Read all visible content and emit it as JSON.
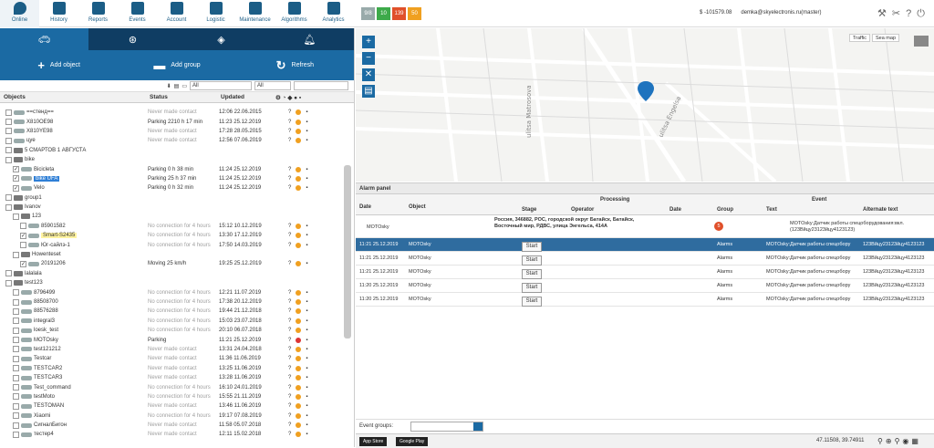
{
  "nav": [
    {
      "label": "Online",
      "icon": "pin-icon"
    },
    {
      "label": "History",
      "icon": "clock-icon"
    },
    {
      "label": "Reports",
      "icon": "reports-icon"
    },
    {
      "label": "Events",
      "icon": "bell-icon"
    },
    {
      "label": "Account",
      "icon": "account-icon"
    },
    {
      "label": "Logistic",
      "icon": "truck-icon"
    },
    {
      "label": "Maintenance",
      "icon": "car-icon"
    },
    {
      "label": "Algorithms",
      "icon": "algorithms-icon"
    },
    {
      "label": "Analytics",
      "icon": "analytics-icon"
    }
  ],
  "badges": [
    {
      "text": "9/8",
      "color": "#9aa"
    },
    {
      "text": "10",
      "color": "#3daa4a"
    },
    {
      "text": "139",
      "color": "#e0502a"
    },
    {
      "text": "50",
      "color": "#f0a020"
    }
  ],
  "account": {
    "balance": "$ -101579.08",
    "user": "demka@skyelectronis.ru(master)"
  },
  "left_tabs": [
    "car-tab",
    "wheel-tab",
    "layers-tab",
    "alarm-tab"
  ],
  "actions": {
    "add_object": "Add object",
    "add_group": "Add group",
    "refresh": "Refresh"
  },
  "filters": {
    "all1": "All",
    "all2": "All"
  },
  "columns": {
    "objects": "Objects",
    "status": "Status",
    "updated": "Updated"
  },
  "rows": [
    {
      "ind": 0,
      "type": "car",
      "name": "==стенд==",
      "status": "Never made contact",
      "updated": "12:06 22.06.2015",
      "gray": true
    },
    {
      "ind": 0,
      "type": "car",
      "name": "X810OE98",
      "status": "Parking 2210 h 17 min",
      "updated": "11:23 25.12.2019",
      "gray": false
    },
    {
      "ind": 0,
      "type": "car",
      "name": "X810YE98",
      "status": "Never made contact",
      "updated": "17:28 28.05.2015",
      "gray": true
    },
    {
      "ind": 0,
      "type": "car",
      "name": "цуе",
      "status": "Never made contact",
      "updated": "12:56 07.06.2019",
      "gray": true
    },
    {
      "ind": 0,
      "type": "folder",
      "name": "5 СМАРТОВ 1 АВГУСТА",
      "status": "",
      "updated": ""
    },
    {
      "ind": 0,
      "type": "folder",
      "name": "bike",
      "status": "",
      "updated": ""
    },
    {
      "ind": 1,
      "type": "car",
      "name": "Bicicleta",
      "status": "Parking 0 h 38 min",
      "updated": "11:24 25.12.2019",
      "gray": false,
      "check": true
    },
    {
      "ind": 1,
      "type": "car",
      "name": "bike UFA",
      "status": "Parking 25 h 37 min",
      "updated": "11:24 25.12.2019",
      "gray": false,
      "check": true,
      "hl": "blue"
    },
    {
      "ind": 1,
      "type": "car",
      "name": "Velo",
      "status": "Parking 0 h 32 min",
      "updated": "11:24 25.12.2019",
      "gray": false,
      "check": true
    },
    {
      "ind": 0,
      "type": "folder",
      "name": "group1",
      "status": "",
      "updated": ""
    },
    {
      "ind": 0,
      "type": "folder",
      "name": "Ivanov",
      "status": "",
      "updated": ""
    },
    {
      "ind": 1,
      "type": "folder",
      "name": "123",
      "status": "",
      "updated": ""
    },
    {
      "ind": 2,
      "type": "car",
      "name": "85901582",
      "status": "No connection for 4 hours",
      "updated": "15:12 10.12.2019",
      "gray": true
    },
    {
      "ind": 2,
      "type": "car",
      "name": "Smart-S2435",
      "status": "No connection for 4 hours",
      "updated": "13:30 17.12.2019",
      "gray": true,
      "check": true,
      "hl": "yellow"
    },
    {
      "ind": 2,
      "type": "car",
      "name": "Юг-сайлэ-1",
      "status": "No connection for 4 hours",
      "updated": "17:50 14.03.2019",
      "gray": true
    },
    {
      "ind": 1,
      "type": "folder",
      "name": "Howenteset",
      "status": "",
      "updated": ""
    },
    {
      "ind": 2,
      "type": "car",
      "name": "20191206",
      "status": "Moving 25 km/h",
      "updated": "19:25 25.12.2019",
      "gray": false,
      "check": true
    },
    {
      "ind": 0,
      "type": "folder",
      "name": "lalalala",
      "status": "",
      "updated": ""
    },
    {
      "ind": 0,
      "type": "folder",
      "name": "test123",
      "status": "",
      "updated": ""
    },
    {
      "ind": 1,
      "type": "car",
      "name": "8796499",
      "status": "No connection for 4 hours",
      "updated": "12:21 11.07.2019",
      "gray": true
    },
    {
      "ind": 1,
      "type": "car",
      "name": "88508700",
      "status": "No connection for 4 hours",
      "updated": "17:38 20.12.2019",
      "gray": true
    },
    {
      "ind": 1,
      "type": "car",
      "name": "88576288",
      "status": "No connection for 4 hours",
      "updated": "19:44 21.12.2018",
      "gray": true
    },
    {
      "ind": 1,
      "type": "car",
      "name": "integral3",
      "status": "No connection for 4 hours",
      "updated": "15:03 23.07.2018",
      "gray": true
    },
    {
      "ind": 1,
      "type": "car",
      "name": "loesk_test",
      "status": "No connection for 4 hours",
      "updated": "20:10 06.07.2018",
      "gray": true
    },
    {
      "ind": 1,
      "type": "car",
      "name": "MOTOsky",
      "status": "Parking",
      "updated": "11:21 25.12.2019",
      "gray": false
    },
    {
      "ind": 1,
      "type": "car",
      "name": "test121212",
      "status": "Never made contact",
      "updated": "13:31 24.04.2018",
      "gray": true
    },
    {
      "ind": 1,
      "type": "car",
      "name": "Testcar",
      "status": "Never made contact",
      "updated": "11:36 11.06.2019",
      "gray": true
    },
    {
      "ind": 1,
      "type": "car",
      "name": "TESTCAR2",
      "status": "Never made contact",
      "updated": "13:25 11.06.2019",
      "gray": true
    },
    {
      "ind": 1,
      "type": "car",
      "name": "TESTCAR3",
      "status": "Never made contact",
      "updated": "13:28 11.06.2019",
      "gray": true
    },
    {
      "ind": 1,
      "type": "car",
      "name": "Test_command",
      "status": "No connection for 4 hours",
      "updated": "16:10 24.01.2019",
      "gray": true
    },
    {
      "ind": 1,
      "type": "car",
      "name": "testMoto",
      "status": "No connection for 4 hours",
      "updated": "15:55 21.11.2019",
      "gray": true
    },
    {
      "ind": 1,
      "type": "car",
      "name": "TESTOMAN",
      "status": "Never made contact",
      "updated": "13:46 11.06.2019",
      "gray": true
    },
    {
      "ind": 1,
      "type": "car",
      "name": "Xiaomi",
      "status": "No connection for 4 hours",
      "updated": "19:17 07.08.2019",
      "gray": true
    },
    {
      "ind": 1,
      "type": "car",
      "name": "СигналБигон",
      "status": "Never made contact",
      "updated": "11:58 05.07.2018",
      "gray": true
    },
    {
      "ind": 1,
      "type": "car",
      "name": "тестер4",
      "status": "Never made contact",
      "updated": "12:11 15.02.2018",
      "gray": true
    }
  ],
  "map": {
    "traffic": "Traffic",
    "sea_map": "Sea map",
    "street1": "ulitsa Matrosova",
    "street2": "ulitsa Engelsa"
  },
  "alarm_panel": {
    "title": "Alarm panel",
    "headers": {
      "date": "Date",
      "object": "Object",
      "processing": "Processing",
      "stage": "Stage",
      "operator": "Operator",
      "pdate": "Date",
      "group": "Group",
      "event": "Event",
      "text": "Text",
      "alt": "Alternate text"
    },
    "first": {
      "object": "MOTOsky",
      "address": "Россия, 346882, РОС, городской округ Батайск, Батайск, Восточный мир, РДВС, улица Энгельса, 414А",
      "group": "5",
      "text": "MOTOsky:Датчик работы спецоборудования:вкл. (123Bйцу23123йцу4123123)"
    },
    "rows": [
      {
        "date": "11:21 25.12.2019",
        "object": "MOTOsky",
        "stage": "Start",
        "group": "Alarms",
        "text": "MOTOsky:Датчик работы спецобору",
        "alt": "123Bйцу23123йцу4123123",
        "sel": true
      },
      {
        "date": "11:21 25.12.2019",
        "object": "MOTOsky",
        "stage": "Start",
        "group": "Alarms",
        "text": "MOTOsky:Датчик работы спецобору",
        "alt": "123Bйцу23123йцу4123123",
        "sel": false
      },
      {
        "date": "11:21 25.12.2019",
        "object": "MOTOsky",
        "stage": "Start",
        "group": "Alarms",
        "text": "MOTOsky:Датчик работы спецобору",
        "alt": "123Bйцу23123йцу4123123",
        "sel": false
      },
      {
        "date": "11:20 25.12.2019",
        "object": "MOTOsky",
        "stage": "Start",
        "group": "Alarms",
        "text": "MOTOsky:Датчик работы спецобору",
        "alt": "123Bйцу23123йцу4123123",
        "sel": false
      },
      {
        "date": "11:20 25.12.2019",
        "object": "MOTOsky",
        "stage": "Start",
        "group": "Alarms",
        "text": "MOTOsky:Датчик работы спецобору",
        "alt": "123Bйцу23123йцу4123123",
        "sel": false
      }
    ],
    "event_groups_label": "Event groups:"
  },
  "footer": {
    "app_store": "App Store",
    "google_play": "Google Play",
    "coords": "47.11508, 39.74911"
  }
}
